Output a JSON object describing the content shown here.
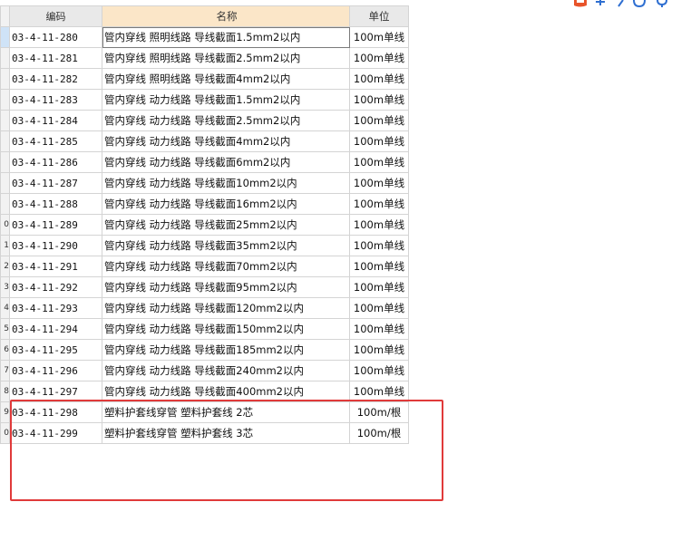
{
  "table": {
    "headers": {
      "code": "编码",
      "name": "名称",
      "unit": "单位"
    },
    "rows": [
      {
        "rownum": "",
        "code": "03-4-11-280",
        "name": "管内穿线 照明线路 导线截面1.5mm2以内",
        "unit": "100m单线"
      },
      {
        "rownum": "",
        "code": "03-4-11-281",
        "name": "管内穿线 照明线路 导线截面2.5mm2以内",
        "unit": "100m单线"
      },
      {
        "rownum": "",
        "code": "03-4-11-282",
        "name": "管内穿线 照明线路 导线截面4mm2以内",
        "unit": "100m单线"
      },
      {
        "rownum": "",
        "code": "03-4-11-283",
        "name": "管内穿线 动力线路 导线截面1.5mm2以内",
        "unit": "100m单线"
      },
      {
        "rownum": "",
        "code": "03-4-11-284",
        "name": "管内穿线 动力线路 导线截面2.5mm2以内",
        "unit": "100m单线"
      },
      {
        "rownum": "",
        "code": "03-4-11-285",
        "name": "管内穿线 动力线路 导线截面4mm2以内",
        "unit": "100m单线"
      },
      {
        "rownum": "",
        "code": "03-4-11-286",
        "name": "管内穿线 动力线路 导线截面6mm2以内",
        "unit": "100m单线"
      },
      {
        "rownum": "",
        "code": "03-4-11-287",
        "name": "管内穿线 动力线路 导线截面10mm2以内",
        "unit": "100m单线"
      },
      {
        "rownum": "",
        "code": "03-4-11-288",
        "name": "管内穿线 动力线路 导线截面16mm2以内",
        "unit": "100m单线"
      },
      {
        "rownum": "0",
        "code": "03-4-11-289",
        "name": "管内穿线 动力线路 导线截面25mm2以内",
        "unit": "100m单线"
      },
      {
        "rownum": "1",
        "code": "03-4-11-290",
        "name": "管内穿线 动力线路 导线截面35mm2以内",
        "unit": "100m单线"
      },
      {
        "rownum": "2",
        "code": "03-4-11-291",
        "name": "管内穿线 动力线路 导线截面70mm2以内",
        "unit": "100m单线"
      },
      {
        "rownum": "3",
        "code": "03-4-11-292",
        "name": "管内穿线 动力线路 导线截面95mm2以内",
        "unit": "100m单线"
      },
      {
        "rownum": "4",
        "code": "03-4-11-293",
        "name": "管内穿线 动力线路 导线截面120mm2以内",
        "unit": "100m单线"
      },
      {
        "rownum": "5",
        "code": "03-4-11-294",
        "name": "管内穿线 动力线路 导线截面150mm2以内",
        "unit": "100m单线"
      },
      {
        "rownum": "6",
        "code": "03-4-11-295",
        "name": "管内穿线 动力线路 导线截面185mm2以内",
        "unit": "100m单线"
      },
      {
        "rownum": "7",
        "code": "03-4-11-296",
        "name": "管内穿线 动力线路 导线截面240mm2以内",
        "unit": "100m单线"
      },
      {
        "rownum": "8",
        "code": "03-4-11-297",
        "name": "管内穿线 动力线路 导线截面400mm2以内",
        "unit": "100m单线"
      },
      {
        "rownum": "9",
        "code": "03-4-11-298",
        "name": "塑料护套线穿管 塑料护套线 2芯",
        "unit": "100m/根"
      },
      {
        "rownum": "0",
        "code": "03-4-11-299",
        "name": "塑料护套线穿管 塑料护套线 3芯",
        "unit": "100m/根"
      }
    ]
  },
  "annotation": {
    "color": "#e03a3a"
  },
  "logo": {
    "icon": "app-logo-icon"
  }
}
